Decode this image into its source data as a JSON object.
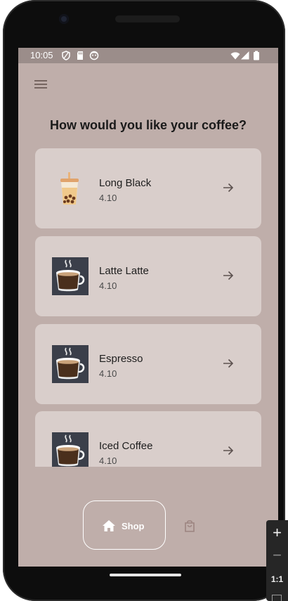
{
  "status_bar": {
    "time": "10:05",
    "icons": [
      "shield-icon",
      "sd-card-icon",
      "face-icon",
      "wifi-icon",
      "signal-icon",
      "battery-icon"
    ]
  },
  "header": {
    "menu_icon": "menu-icon",
    "title": "How would you like your coffee?"
  },
  "products": [
    {
      "name": "Long Black",
      "price": "4.10",
      "image": "bubble-tea"
    },
    {
      "name": "Latte Latte",
      "price": "4.10",
      "image": "coffee-cup"
    },
    {
      "name": "Espresso",
      "price": "4.10",
      "image": "coffee-cup"
    },
    {
      "name": "Iced Coffee",
      "price": "4.10",
      "image": "coffee-cup"
    }
  ],
  "bottom_nav": {
    "shop_label": "Shop",
    "shop_icon": "home-icon",
    "cart_icon": "shopping-bag-icon"
  },
  "emulator_controls": {
    "zoom_in": "+",
    "zoom_out": "−",
    "reset": "1:1"
  },
  "colors": {
    "screen_bg": "#bfaeaa",
    "card_bg": "#d9cecb",
    "status_bar": "#9b8d8a"
  }
}
